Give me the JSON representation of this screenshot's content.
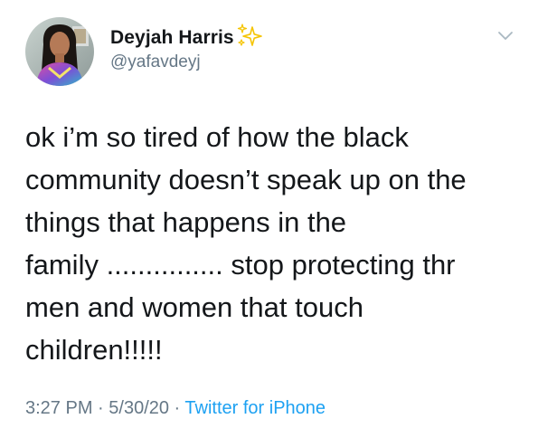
{
  "tweet": {
    "author": {
      "display_name": "Deyjah Harris",
      "handle": "@yafavdeyj",
      "avatar_icon": "profile-photo",
      "name_emoji_icon": "sparkles-icon"
    },
    "menu_icon": "chevron-down-icon",
    "text_lines": [
      "ok i’m so tired of how the black",
      "community doesn’t speak up on the",
      "things that happens in the",
      "family ............... stop protecting thr",
      "men and women that touch",
      "children!!!!!"
    ],
    "meta": {
      "time": "3:27 PM",
      "separator": " · ",
      "date": "5/30/20",
      "source": "Twitter for iPhone"
    }
  },
  "colors": {
    "text_primary": "#14171a",
    "text_secondary": "#657786",
    "link_blue": "#1da1f2",
    "sparkle_gold": "#f5c400",
    "chevron_gray": "#aab8c2"
  }
}
